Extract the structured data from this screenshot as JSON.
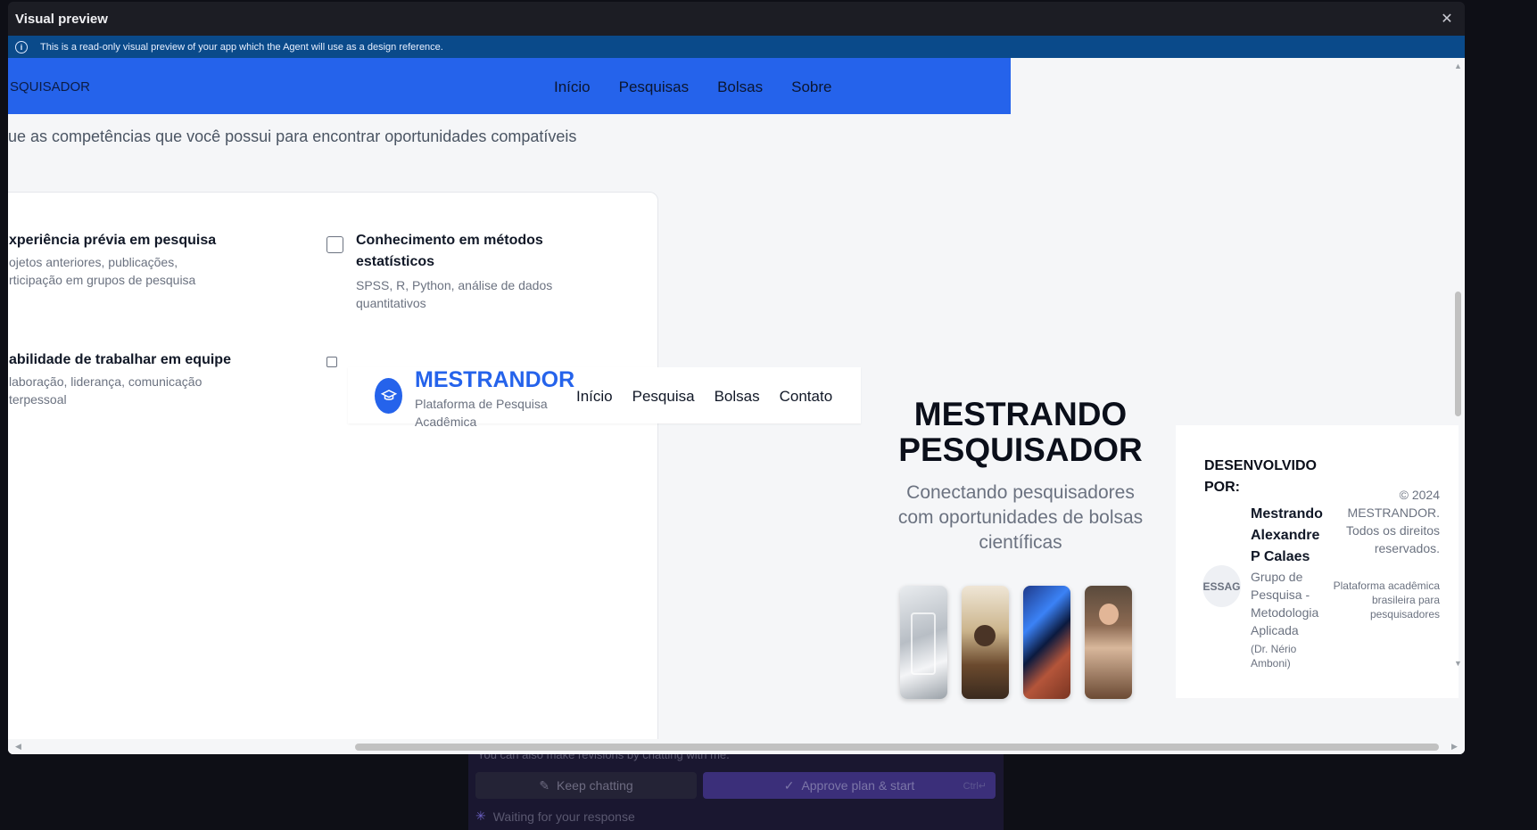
{
  "background_app": {
    "hint_text": "You can also make revisions by chatting with me.",
    "keep_chatting_label": "Keep chatting",
    "approve_label": "Approve plan & start",
    "approve_shortcut": "Ctrl↵",
    "waiting_text": "Waiting for your response"
  },
  "modal": {
    "title": "Visual preview",
    "banner_text": "This is a read-only visual preview of your app which the Agent will use as a design reference."
  },
  "navbar": {
    "brand": "SQUISADOR",
    "links": [
      "Início",
      "Pesquisas",
      "Bolsas",
      "Sobre"
    ]
  },
  "subtitle": "ue as competências que você possui para encontrar oportunidades compatíveis",
  "competencies": [
    {
      "title": "xperiência prévia em pesquisa",
      "desc": "ojetos anteriores, publicações, rticipação em grupos de pesquisa"
    },
    {
      "title": "Conhecimento em métodos estatísticos",
      "desc": "SPSS, R, Python, análise de dados quantitativos"
    },
    {
      "title": "abilidade de trabalhar em equipe",
      "desc": "laboração, liderança, comunicação terpessoal"
    }
  ],
  "mini_header": {
    "brand": "MESTRANDOR",
    "tagline": "Plataforma de Pesquisa Acadêmica",
    "links": [
      "Início",
      "Pesquisa",
      "Bolsas",
      "Contato"
    ]
  },
  "hero": {
    "title": "MESTRANDO PESQUISADOR",
    "subtitle": "Conectando pesquisadores com oportunidades de bolsas científicas"
  },
  "footer": {
    "developed_by_label": "DESENVOLVIDO POR:",
    "logo_text": "ESSAG",
    "developer_name": "Mestrando Alexandre P Calaes",
    "group": "Grupo de Pesquisa - Metodologia Aplicada",
    "advisor": "(Dr. Nério Amboni)",
    "copyright": "© 2024 MESTRANDOR. Todos os direitos reservados.",
    "platform_note": "Plataforma acadêmica brasileira para pesquisadores"
  }
}
